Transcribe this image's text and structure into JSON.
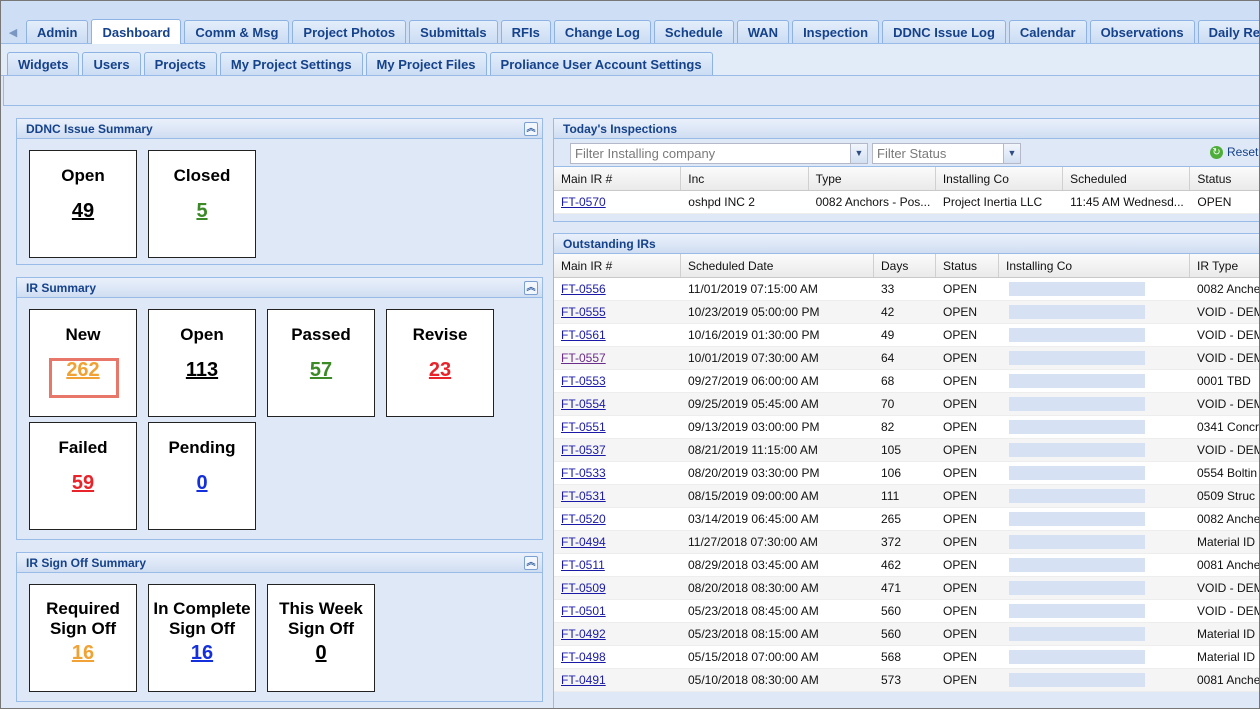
{
  "top_tabs": [
    "Admin",
    "Dashboard",
    "Comm & Msg",
    "Project Photos",
    "Submittals",
    "RFIs",
    "Change Log",
    "Schedule",
    "WAN",
    "Inspection",
    "DDNC Issue Log",
    "Calendar",
    "Observations",
    "Daily Reports"
  ],
  "active_top_tab": "Dashboard",
  "sub_tabs": [
    "Widgets",
    "Users",
    "Projects",
    "My Project Settings",
    "My Project Files",
    "Proliance User Account Settings"
  ],
  "ddnc": {
    "title": "DDNC Issue Summary",
    "open_label": "Open",
    "open_value": "49",
    "closed_label": "Closed",
    "closed_value": "5"
  },
  "ir_summary": {
    "title": "IR Summary",
    "new_label": "New",
    "new_value": "262",
    "open_label": "Open",
    "open_value": "113",
    "passed_label": "Passed",
    "passed_value": "57",
    "revise_label": "Revise",
    "revise_value": "23",
    "failed_label": "Failed",
    "failed_value": "59",
    "pending_label": "Pending",
    "pending_value": "0"
  },
  "signoff": {
    "title": "IR Sign Off Summary",
    "required_l1": "Required",
    "required_l2": "Sign Off",
    "required_value": "16",
    "incomplete_l1": "In Complete",
    "incomplete_l2": "Sign Off",
    "incomplete_value": "16",
    "week_l1": "This Week",
    "week_l2": "Sign Off",
    "week_value": "0"
  },
  "todays": {
    "title": "Today's Inspections",
    "filter_company_placeholder": "Filter Installing company",
    "filter_status_placeholder": "Filter Status",
    "reset_label": "Reset",
    "columns": [
      "Main IR #",
      "Inc",
      "Type",
      "Installing Co",
      "Scheduled",
      "Status"
    ],
    "row": [
      "FT-0570",
      "oshpd INC 2",
      "0082 Anchors - Pos...",
      "Project Inertia LLC",
      "11:45 AM Wednesd...",
      "OPEN"
    ]
  },
  "outstanding": {
    "title": "Outstanding IRs",
    "columns": [
      "Main IR #",
      "Scheduled Date",
      "Days",
      "Status",
      "Installing Co",
      "IR Type"
    ],
    "rows": [
      [
        "FT-0556",
        "11/01/2019 07:15:00 AM",
        "33",
        "OPEN",
        "0082 Anche"
      ],
      [
        "FT-0555",
        "10/23/2019 05:00:00 PM",
        "42",
        "OPEN",
        "VOID - DEM"
      ],
      [
        "FT-0561",
        "10/16/2019 01:30:00 PM",
        "49",
        "OPEN",
        "VOID - DEM"
      ],
      [
        "FT-0557",
        "10/01/2019 07:30:00 AM",
        "64",
        "OPEN",
        "VOID - DEM"
      ],
      [
        "FT-0553",
        "09/27/2019 06:00:00 AM",
        "68",
        "OPEN",
        "0001 TBD"
      ],
      [
        "FT-0554",
        "09/25/2019 05:45:00 AM",
        "70",
        "OPEN",
        "VOID - DEM"
      ],
      [
        "FT-0551",
        "09/13/2019 03:00:00 PM",
        "82",
        "OPEN",
        "0341 Concr"
      ],
      [
        "FT-0537",
        "08/21/2019 11:15:00 AM",
        "105",
        "OPEN",
        "VOID - DEM"
      ],
      [
        "FT-0533",
        "08/20/2019 03:30:00 PM",
        "106",
        "OPEN",
        "0554 Boltin"
      ],
      [
        "FT-0531",
        "08/15/2019 09:00:00 AM",
        "111",
        "OPEN",
        "0509 Struc"
      ],
      [
        "FT-0520",
        "03/14/2019 06:45:00 AM",
        "265",
        "OPEN",
        "0082 Anche"
      ],
      [
        "FT-0494",
        "11/27/2018 07:30:00 AM",
        "372",
        "OPEN",
        "Material ID"
      ],
      [
        "FT-0511",
        "08/29/2018 03:45:00 AM",
        "462",
        "OPEN",
        "0081 Anche"
      ],
      [
        "FT-0509",
        "08/20/2018 08:30:00 AM",
        "471",
        "OPEN",
        "VOID - DEM"
      ],
      [
        "FT-0501",
        "05/23/2018 08:45:00 AM",
        "560",
        "OPEN",
        "VOID - DEM"
      ],
      [
        "FT-0492",
        "05/23/2018 08:15:00 AM",
        "560",
        "OPEN",
        "Material ID"
      ],
      [
        "FT-0498",
        "05/15/2018 07:00:00 AM",
        "568",
        "OPEN",
        "Material ID"
      ],
      [
        "FT-0491",
        "05/10/2018 08:30:00 AM",
        "573",
        "OPEN",
        "0081 Anche"
      ]
    ]
  },
  "colors": {
    "panel_bg": "#dfe8f6",
    "header_text": "#15428b",
    "highlight": "#e8776a",
    "green": "#3b8a26",
    "orange": "#f0a234",
    "red": "#e8232a",
    "blue": "#1430dc"
  }
}
